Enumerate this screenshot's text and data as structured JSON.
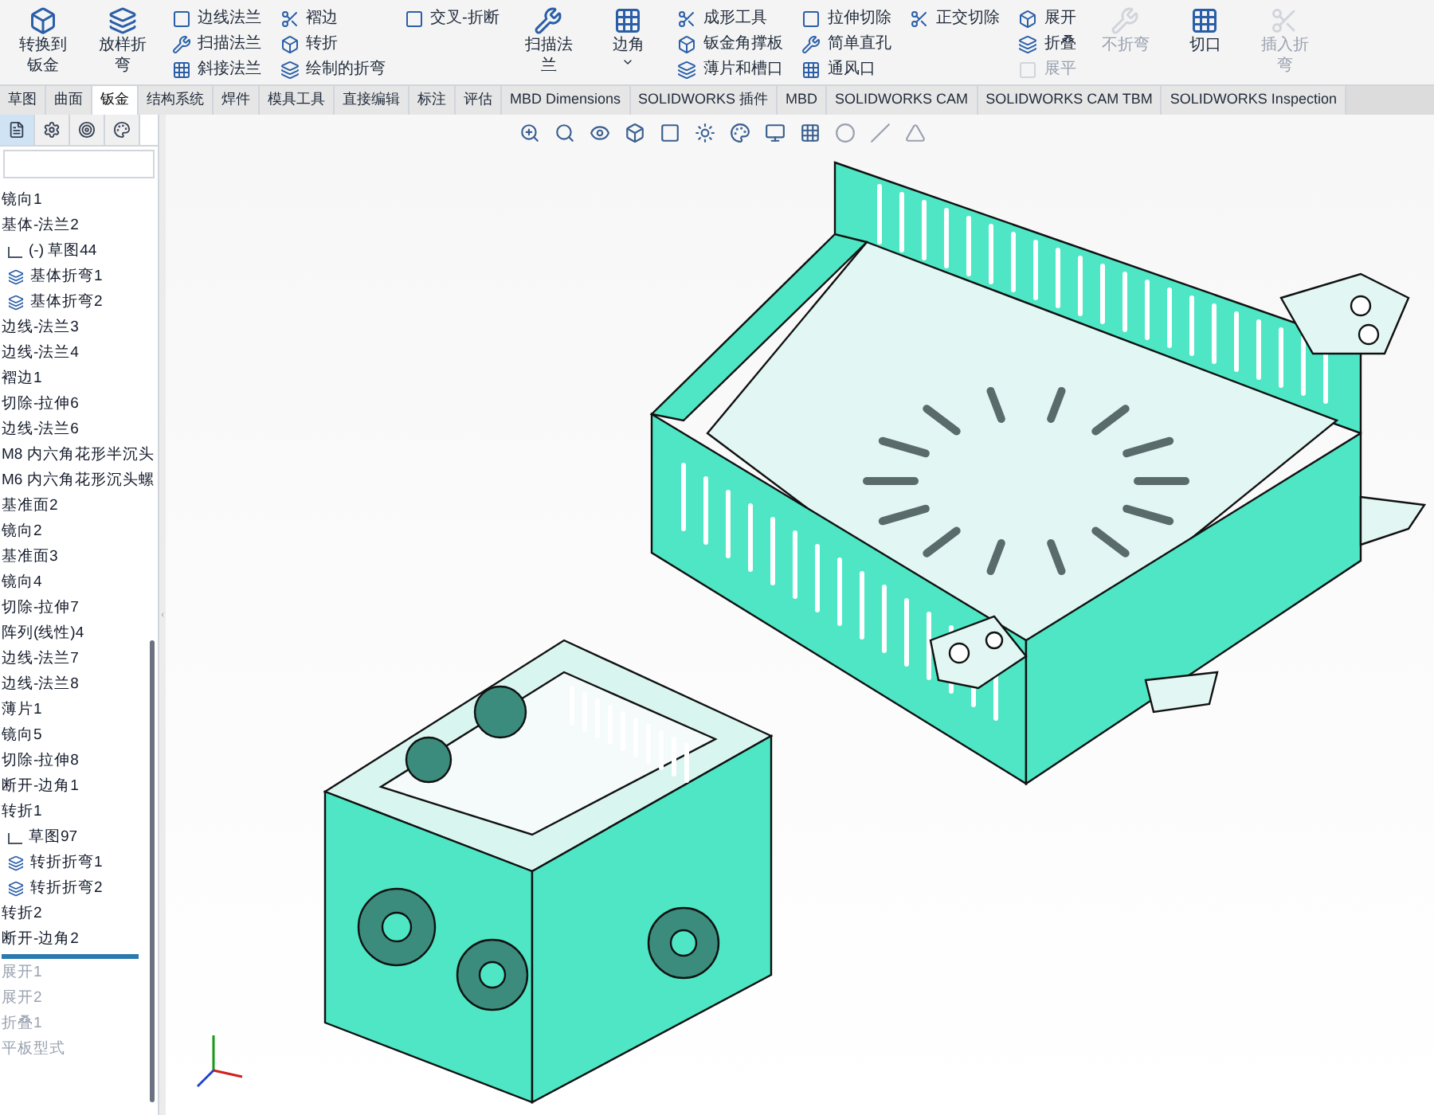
{
  "ribbon": {
    "groups": [
      {
        "kind": "large",
        "items": [
          {
            "label": "转换到钣金",
            "disabled": false
          }
        ]
      },
      {
        "kind": "large",
        "items": [
          {
            "label": "放样折弯",
            "disabled": false
          }
        ]
      },
      {
        "kind": "column",
        "items": [
          {
            "label": "边线法兰",
            "disabled": false
          },
          {
            "label": "扫描法兰",
            "disabled": false
          },
          {
            "label": "斜接法兰",
            "disabled": false
          }
        ]
      },
      {
        "kind": "column",
        "items": [
          {
            "label": "褶边",
            "disabled": false
          },
          {
            "label": "转折",
            "disabled": false
          },
          {
            "label": "绘制的折弯",
            "disabled": false
          }
        ]
      },
      {
        "kind": "column",
        "items": [
          {
            "label": "交叉-折断",
            "disabled": false
          }
        ]
      },
      {
        "kind": "large",
        "items": [
          {
            "label": "扫描法兰",
            "disabled": false
          }
        ]
      },
      {
        "kind": "dropdown",
        "items": [
          {
            "label": "边角",
            "disabled": false
          }
        ]
      },
      {
        "kind": "column",
        "items": [
          {
            "label": "成形工具",
            "disabled": false
          },
          {
            "label": "钣金角撑板",
            "disabled": false
          },
          {
            "label": "薄片和槽口",
            "disabled": false
          }
        ]
      },
      {
        "kind": "column",
        "items": [
          {
            "label": "拉伸切除",
            "disabled": false
          },
          {
            "label": "简单直孔",
            "disabled": false
          },
          {
            "label": "通风口",
            "disabled": false
          }
        ]
      },
      {
        "kind": "column",
        "items": [
          {
            "label": "正交切除",
            "disabled": false
          }
        ]
      },
      {
        "kind": "column",
        "items": [
          {
            "label": "展开",
            "disabled": false
          },
          {
            "label": "折叠",
            "disabled": false
          },
          {
            "label": "展平",
            "disabled": true
          }
        ]
      },
      {
        "kind": "large",
        "items": [
          {
            "label": "不折弯",
            "disabled": true
          }
        ]
      },
      {
        "kind": "large",
        "items": [
          {
            "label": "切口",
            "disabled": false
          }
        ]
      },
      {
        "kind": "large",
        "items": [
          {
            "label": "插入折弯",
            "disabled": true
          }
        ]
      }
    ]
  },
  "tabs": [
    {
      "label": "草图",
      "selected": false
    },
    {
      "label": "曲面",
      "selected": false
    },
    {
      "label": "钣金",
      "selected": true
    },
    {
      "label": "结构系统",
      "selected": false
    },
    {
      "label": "焊件",
      "selected": false
    },
    {
      "label": "模具工具",
      "selected": false
    },
    {
      "label": "直接编辑",
      "selected": false
    },
    {
      "label": "标注",
      "selected": false
    },
    {
      "label": "评估",
      "selected": false
    },
    {
      "label": "MBD Dimensions",
      "selected": false
    },
    {
      "label": "SOLIDWORKS 插件",
      "selected": false
    },
    {
      "label": "MBD",
      "selected": false
    },
    {
      "label": "SOLIDWORKS CAM",
      "selected": false
    },
    {
      "label": "SOLIDWORKS CAM TBM",
      "selected": false
    },
    {
      "label": "SOLIDWORKS Inspection",
      "selected": false
    }
  ],
  "feature_tree": {
    "panel_tabs": [
      {
        "selected": true
      },
      {
        "selected": false
      },
      {
        "selected": false
      },
      {
        "selected": false
      }
    ],
    "items": [
      {
        "kind": "feature",
        "label": "镜向1",
        "suppressed": false
      },
      {
        "kind": "feature",
        "label": "基体-法兰2",
        "suppressed": false,
        "children": [
          {
            "kind": "sketch",
            "label": "(-) 草图44",
            "suppressed": false
          },
          {
            "kind": "bend",
            "label": "基体折弯1",
            "suppressed": false
          },
          {
            "kind": "bend",
            "label": "基体折弯2",
            "suppressed": false
          }
        ]
      },
      {
        "kind": "feature",
        "label": "边线-法兰3",
        "suppressed": false
      },
      {
        "kind": "feature",
        "label": "边线-法兰4",
        "suppressed": false
      },
      {
        "kind": "feature",
        "label": "褶边1",
        "suppressed": false
      },
      {
        "kind": "feature",
        "label": "切除-拉伸6",
        "suppressed": false
      },
      {
        "kind": "feature",
        "label": "边线-法兰6",
        "suppressed": false
      },
      {
        "kind": "feature",
        "label": "M8 内六角花形半沉头",
        "suppressed": false
      },
      {
        "kind": "feature",
        "label": "M6 内六角花形沉头螺",
        "suppressed": false
      },
      {
        "kind": "feature",
        "label": "基准面2",
        "suppressed": false
      },
      {
        "kind": "feature",
        "label": "镜向2",
        "suppressed": false
      },
      {
        "kind": "feature",
        "label": "基准面3",
        "suppressed": false
      },
      {
        "kind": "feature",
        "label": "镜向4",
        "suppressed": false
      },
      {
        "kind": "feature",
        "label": "切除-拉伸7",
        "suppressed": false
      },
      {
        "kind": "feature",
        "label": "阵列(线性)4",
        "suppressed": false
      },
      {
        "kind": "feature",
        "label": "边线-法兰7",
        "suppressed": false
      },
      {
        "kind": "feature",
        "label": "边线-法兰8",
        "suppressed": false
      },
      {
        "kind": "feature",
        "label": "薄片1",
        "suppressed": false
      },
      {
        "kind": "feature",
        "label": "镜向5",
        "suppressed": false
      },
      {
        "kind": "feature",
        "label": "切除-拉伸8",
        "suppressed": false
      },
      {
        "kind": "feature",
        "label": "断开-边角1",
        "suppressed": false
      },
      {
        "kind": "feature",
        "label": "转折1",
        "suppressed": false,
        "children": [
          {
            "kind": "sketch",
            "label": "草图97",
            "suppressed": false
          },
          {
            "kind": "bend",
            "label": "转折折弯1",
            "suppressed": false
          },
          {
            "kind": "bend",
            "label": "转折折弯2",
            "suppressed": false
          }
        ]
      },
      {
        "kind": "feature",
        "label": "转折2",
        "suppressed": false
      },
      {
        "kind": "feature",
        "label": "断开-边角2",
        "suppressed": false
      },
      {
        "kind": "rollback"
      },
      {
        "kind": "feature",
        "label": "展开1",
        "suppressed": true
      },
      {
        "kind": "feature",
        "label": "展开2",
        "suppressed": true
      },
      {
        "kind": "feature",
        "label": "折叠1",
        "suppressed": true
      },
      {
        "kind": "feature",
        "label": "平板型式",
        "suppressed": true
      }
    ]
  }
}
